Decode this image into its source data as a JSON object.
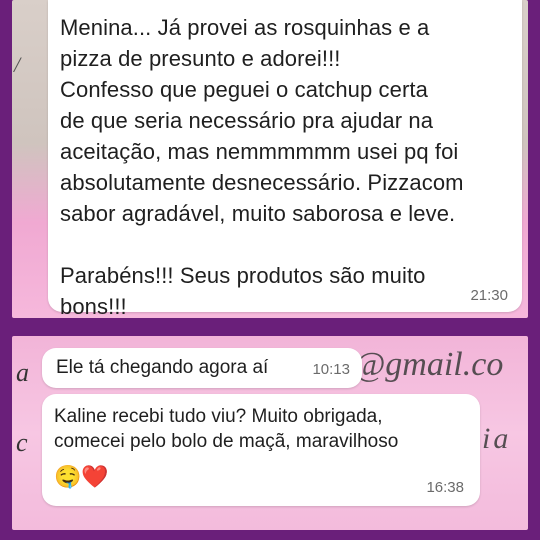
{
  "top_message": {
    "lines": [
      "Menina... Já provei as rosquinhas e a",
      "pizza de presunto e adorei!!!",
      "Confesso que peguei o catchup certa",
      "de que seria necessário pra ajudar na",
      "aceitação, mas nemmmmmm usei pq foi",
      "absolutamente desnecessário. Pizzacom",
      "sabor agradável, muito saborosa e leve.",
      "",
      "Parabéns!!! Seus produtos são muito",
      "bons!!!"
    ],
    "time": "21:30"
  },
  "bottom": {
    "msg1": {
      "text": "Ele tá chegando agora aí",
      "time": "10:13"
    },
    "msg2": {
      "lines": [
        "Kaline recebi tudo viu? Muito obrigada,",
        "comecei pelo bolo de maçã, maravilhoso"
      ],
      "emojis": "🤤❤️",
      "time": "16:38"
    },
    "background_text": {
      "email": "@gmail.co",
      "gia": "gia",
      "left_a": "a",
      "left_c": "c"
    }
  }
}
